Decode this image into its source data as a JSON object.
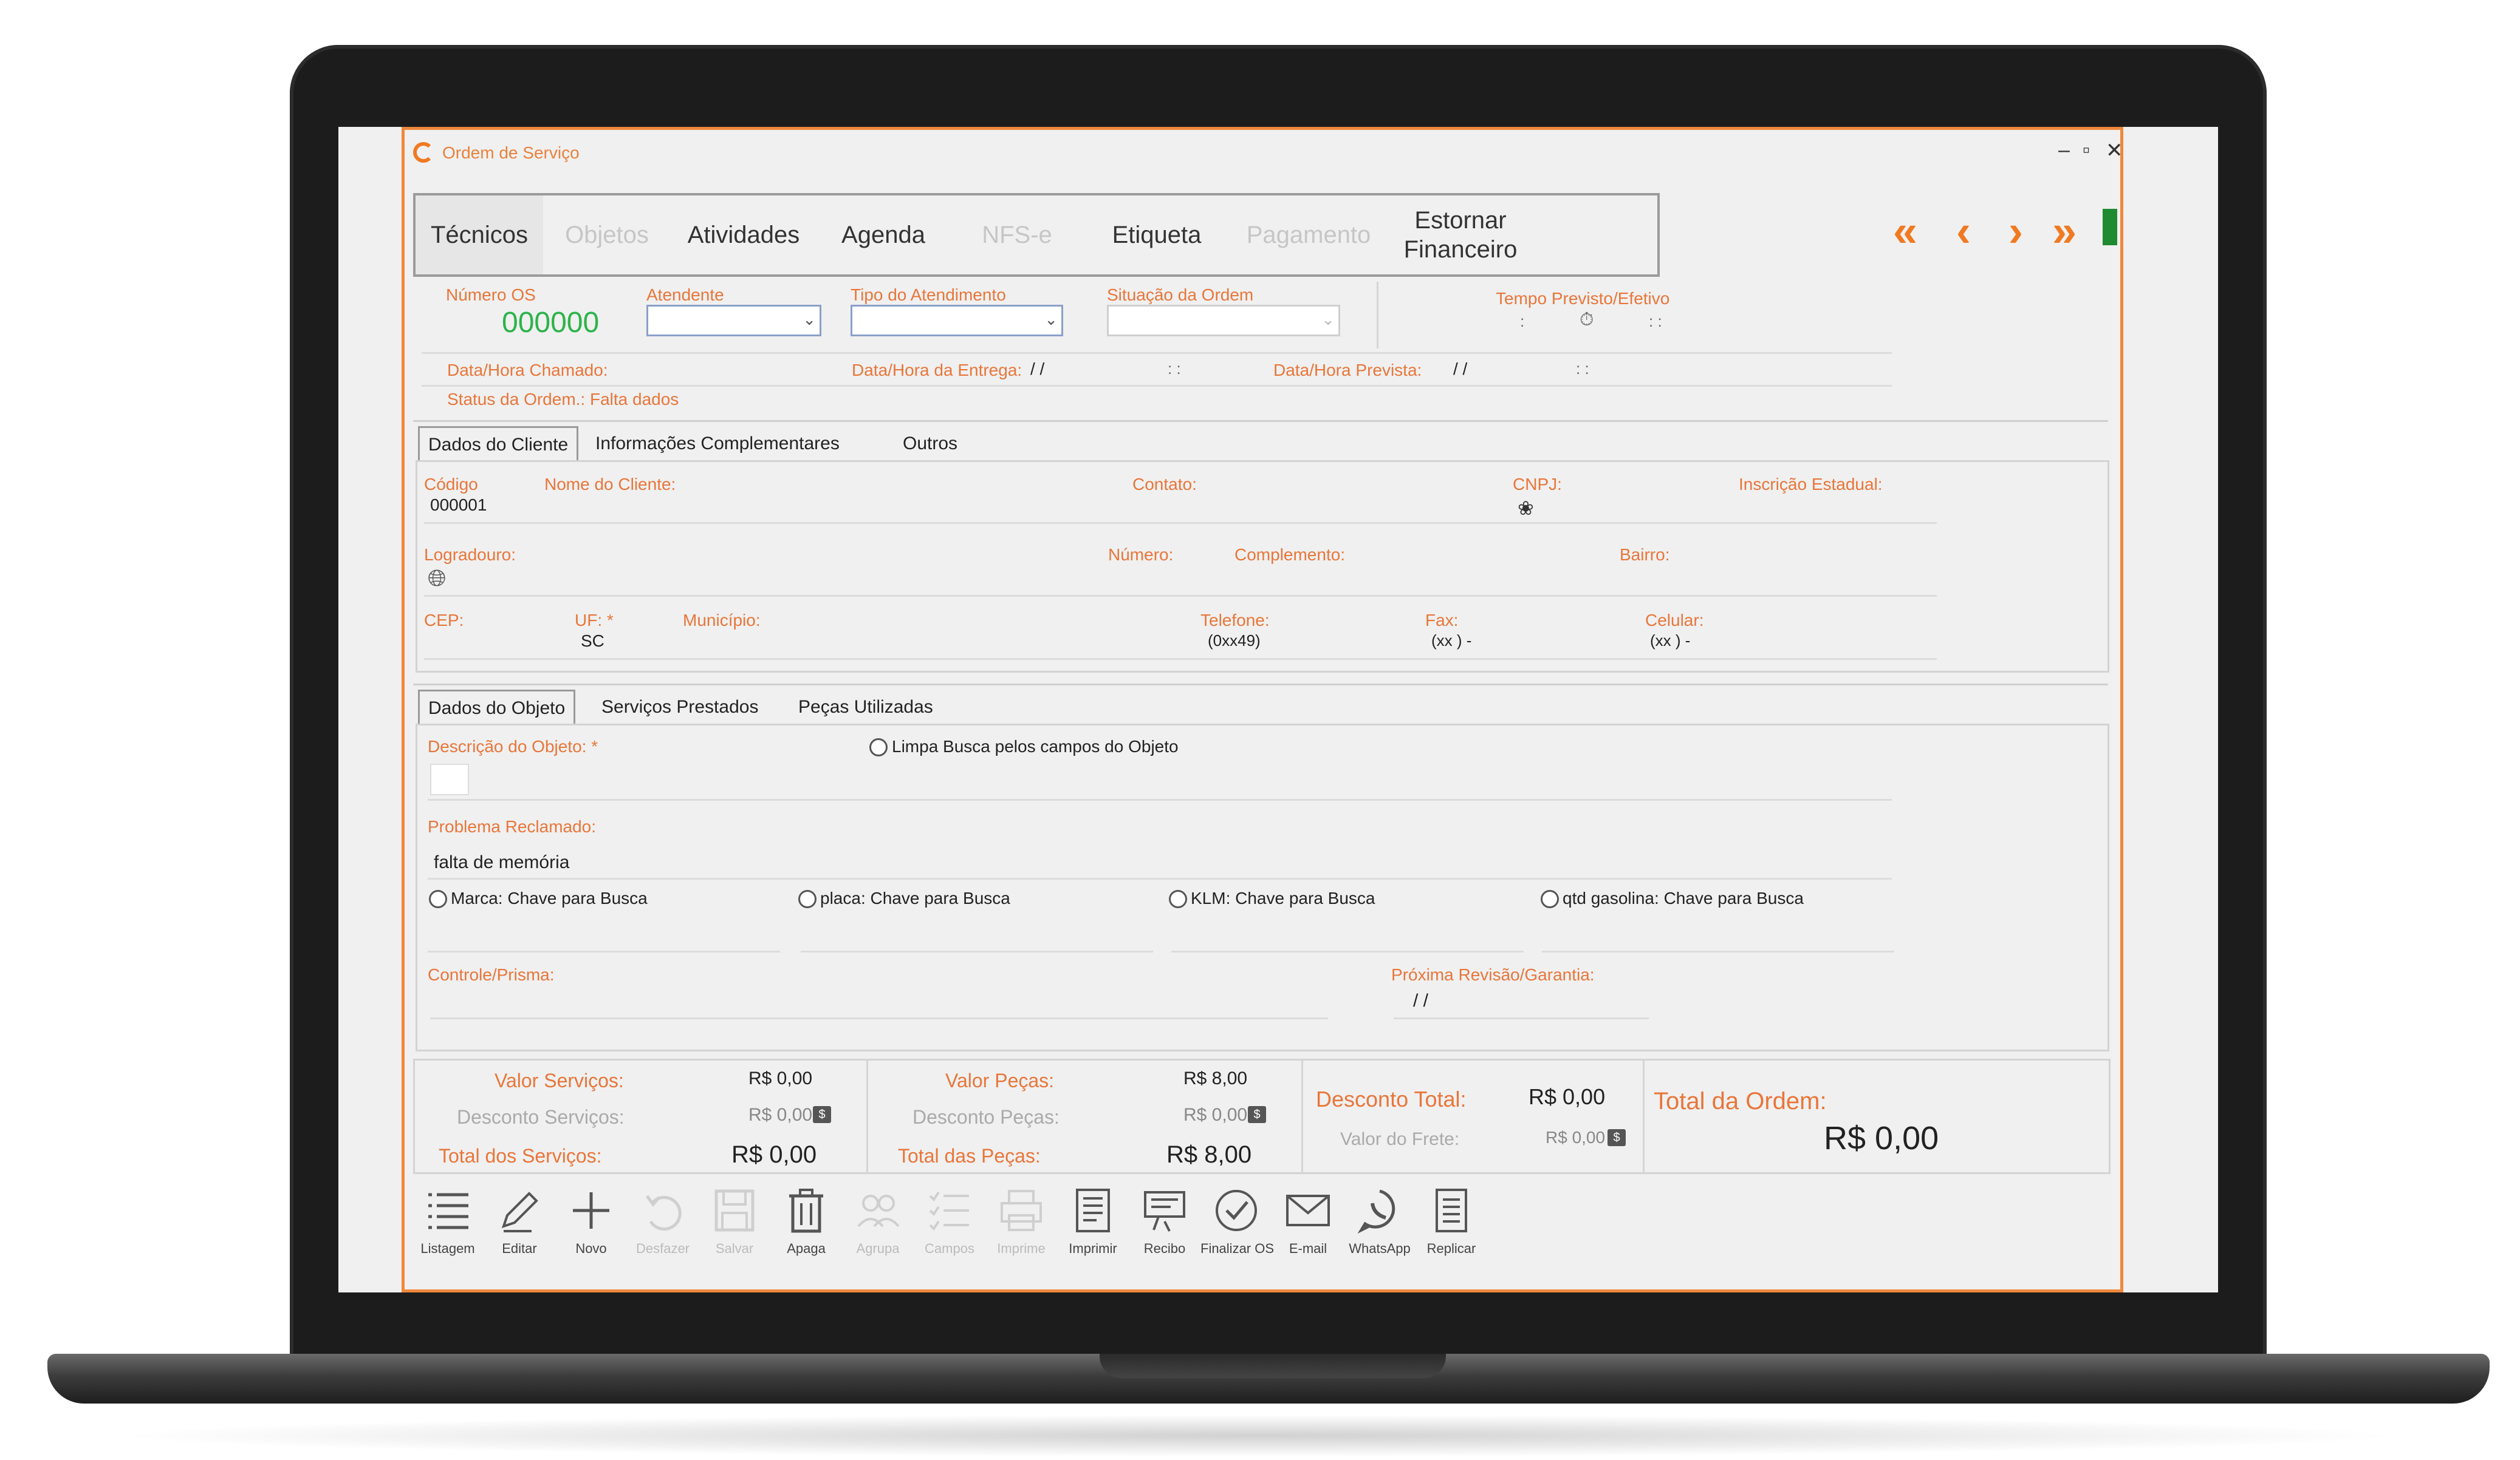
{
  "window": {
    "title": "Ordem de Serviço",
    "min": "–",
    "max": "▫",
    "close": "✕"
  },
  "toolbar": {
    "items": [
      {
        "label": "Técnicos",
        "enabled": true
      },
      {
        "label": "Objetos",
        "enabled": false
      },
      {
        "label": "Atividades",
        "enabled": true
      },
      {
        "label": "Agenda",
        "enabled": true
      },
      {
        "label": "NFS-e",
        "enabled": false
      },
      {
        "label": "Etiqueta",
        "enabled": true
      },
      {
        "label": "Pagamento",
        "enabled": false
      },
      {
        "label": "Estornar Financeiro",
        "enabled": true
      }
    ],
    "nav": {
      "first": "«",
      "prev": "‹",
      "next": "›",
      "last": "»"
    }
  },
  "header": {
    "numero_os_label": "Número OS",
    "numero_os_value": "000000",
    "atendente_label": "Atendente",
    "tipo_atendimento_label": "Tipo do Atendimento",
    "situacao_label": "Situação da Ordem",
    "tempo_label": "Tempo Previsto/Efetivo",
    "tempo_value_left": ":",
    "tempo_value_right": ": :",
    "data_chamado_label": "Data/Hora Chamado:",
    "data_entrega_label": "Data/Hora da Entrega:",
    "data_entrega_value": "/ /",
    "data_entrega_time": ": :",
    "data_prevista_label": "Data/Hora Prevista:",
    "data_prevista_value": "/ /",
    "data_prevista_time": ": :",
    "status_label": "Status da Ordem.: Falta dados"
  },
  "client_tabs": [
    "Dados do Cliente",
    "Informações Complementares",
    "Outros"
  ],
  "client": {
    "codigo_label": "Código",
    "codigo_value": "000001",
    "nome_label": "Nome do Cliente:",
    "contato_label": "Contato:",
    "cnpj_label": "CNPJ:",
    "ie_label": "Inscrição Estadual:",
    "logradouro_label": "Logradouro:",
    "numero_label": "Número:",
    "complemento_label": "Complemento:",
    "bairro_label": "Bairro:",
    "cep_label": "CEP:",
    "uf_label": "UF: *",
    "uf_value": "SC",
    "municipio_label": "Município:",
    "telefone_label": "Telefone:",
    "telefone_value": "(0xx49)",
    "fax_label": "Fax:",
    "fax_value": "(xx )  -",
    "celular_label": "Celular:",
    "celular_value": "(xx )  -"
  },
  "object_tabs": [
    "Dados do Objeto",
    "Serviços Prestados",
    "Peças Utilizadas"
  ],
  "object": {
    "descricao_label": "Descrição do Objeto: *",
    "limpa_busca_label": "Limpa Busca pelos campos do Objeto",
    "problema_label": "Problema Reclamado:",
    "problema_value": "falta de memória",
    "radio_marca": "Marca: Chave para Busca",
    "radio_placa": "placa: Chave para Busca",
    "radio_klm": "KLM: Chave para Busca",
    "radio_qtd": "qtd gasolina: Chave para Busca",
    "controle_label": "Controle/Prisma:",
    "proxima_label": "Próxima Revisão/Garantia:",
    "proxima_value": "/ /"
  },
  "totals": {
    "valor_servicos_label": "Valor Serviços:",
    "valor_servicos_value": "R$ 0,00",
    "desconto_servicos_label": "Desconto Serviços:",
    "desconto_servicos_value": "R$ 0,00",
    "total_servicos_label": "Total dos Serviços:",
    "total_servicos_value": "R$ 0,00",
    "valor_pecas_label": "Valor Peças:",
    "valor_pecas_value": "R$ 8,00",
    "desconto_pecas_label": "Desconto Peças:",
    "desconto_pecas_value": "R$ 0,00",
    "total_pecas_label": "Total das Peças:",
    "total_pecas_value": "R$ 8,00",
    "desconto_total_label": "Desconto Total:",
    "desconto_total_value": "R$ 0,00",
    "valor_frete_label": "Valor do Frete:",
    "valor_frete_value": "R$ 0,00",
    "total_ordem_label": "Total da Ordem:",
    "total_ordem_value": "R$ 0,00",
    "coin_glyph": "$"
  },
  "actions": [
    {
      "label": "Listagem",
      "icon": "list-icon",
      "enabled": true
    },
    {
      "label": "Editar",
      "icon": "pencil-icon",
      "enabled": true
    },
    {
      "label": "Novo",
      "icon": "plus-icon",
      "enabled": true
    },
    {
      "label": "Desfazer",
      "icon": "undo-icon",
      "enabled": false
    },
    {
      "label": "Salvar",
      "icon": "save-icon",
      "enabled": false
    },
    {
      "label": "Apaga",
      "icon": "trash-icon",
      "enabled": true
    },
    {
      "label": "Agrupa",
      "icon": "group-icon",
      "enabled": false
    },
    {
      "label": "Campos",
      "icon": "fields-icon",
      "enabled": false
    },
    {
      "label": "Imprime",
      "icon": "printer-icon",
      "enabled": false
    },
    {
      "label": "Imprimir",
      "icon": "document-icon",
      "enabled": true
    },
    {
      "label": "Recibo",
      "icon": "receipt-icon",
      "enabled": true
    },
    {
      "label": "Finalizar OS",
      "icon": "check-circle-icon",
      "enabled": true
    },
    {
      "label": "E-mail",
      "icon": "mail-icon",
      "enabled": true
    },
    {
      "label": "WhatsApp",
      "icon": "whatsapp-icon",
      "enabled": true
    },
    {
      "label": "Replicar",
      "icon": "replicate-icon",
      "enabled": true
    }
  ],
  "colors": {
    "accent": "#f07a22",
    "label": "#e8763a",
    "os_number": "#2db34a",
    "nav_green": "#1f8a2f"
  }
}
